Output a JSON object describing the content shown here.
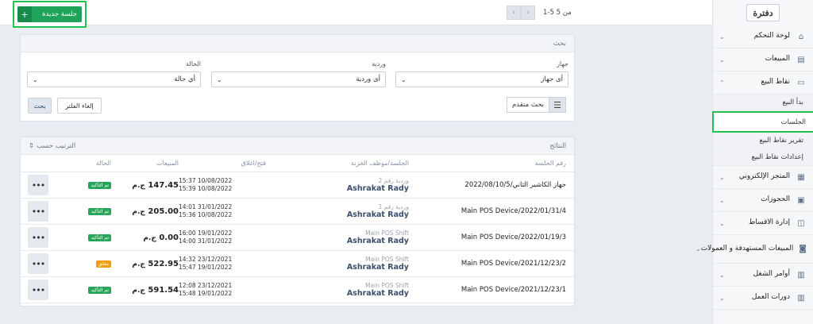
{
  "sidebar": {
    "logo": "دفترة",
    "items": [
      {
        "label": "لوحة التحكم",
        "icon": "home-icon",
        "glyph": "⌂",
        "chevron": "⌄"
      },
      {
        "label": "المبيعات",
        "icon": "sales-icon",
        "glyph": "▤",
        "chevron": "⌄"
      },
      {
        "label": "نقاط البيع",
        "icon": "pos-icon",
        "glyph": "▭",
        "chevron": "⌃"
      }
    ],
    "sub_items": [
      {
        "label": "بدأ البيع"
      },
      {
        "label": "الجلسات"
      },
      {
        "label": "تقرير نقاط البيع"
      },
      {
        "label": "إعدادات نقاط البيع"
      }
    ],
    "items_after": [
      {
        "label": "المتجر الإلكتروني",
        "icon": "store-icon",
        "glyph": "▦",
        "chevron": "⌄"
      },
      {
        "label": "الحجوزات",
        "icon": "calendar-icon",
        "glyph": "▣",
        "chevron": "⌄"
      },
      {
        "label": "إدارة الاقساط",
        "icon": "installments-icon",
        "glyph": "◫",
        "chevron": "⌄"
      },
      {
        "label": "المبيعات المستهدفة و العمولات",
        "icon": "commission-icon",
        "glyph": "◙",
        "chevron": "⌄"
      },
      {
        "label": "أوامر الشغل",
        "icon": "work-order-icon",
        "glyph": "▥",
        "chevron": "⌄"
      },
      {
        "label": "دورات العمل",
        "icon": "workflow-icon",
        "glyph": "▥",
        "chevron": "⌄"
      }
    ]
  },
  "topbar": {
    "new_session": "جلسة جديدة",
    "plus": "+",
    "pager_text": "1-5 من 5",
    "prev": "‹",
    "next": "›"
  },
  "filters": {
    "title": "بحث",
    "device_label": "جهاز",
    "device_value": "أى جهاز",
    "shift_label": "وردية",
    "shift_value": "أى وردية",
    "status_label": "الحالة",
    "status_value": "أي حالة",
    "advanced": "بحث متقدم",
    "clear": "إلغاء الفلتر",
    "search": "بحث",
    "arrow": "⌄"
  },
  "results": {
    "title": "النتائج",
    "sort": "الترتيب حسب",
    "columns": {
      "number": "رقم الجلسة",
      "staff": "الجلسة/موظف الخزنة",
      "time": "فتح/اغلاق",
      "sales": "المبيعات",
      "status": "الحالة"
    },
    "currency": "ج.م",
    "more": "•••",
    "rows": [
      {
        "number": "جهاز الكاشير الثاني/2022/08/10/5",
        "shift": "وردية رقم 2",
        "name": "Ashrakat Rady",
        "open": "15:37 10/08/2022",
        "close": "15:39 10/08/2022",
        "sales": "147.45",
        "status": "تم التأكيد",
        "closed": false
      },
      {
        "number": "Main POS Device/2022/01/31/4",
        "shift": "وردية رقم 1",
        "name": "Ashrakat Rady",
        "open": "14:01 31/01/2022",
        "close": "15:36 10/08/2022",
        "sales": "205.00",
        "status": "تم التأكيد",
        "closed": false
      },
      {
        "number": "Main POS Device/2022/01/19/3",
        "shift": "Main POS Shift",
        "name": "Ashrakat Rady",
        "open": "16:00 19/01/2022",
        "close": "14:00 31/01/2022",
        "sales": "0.00",
        "status": "تم التأكيد",
        "closed": false
      },
      {
        "number": "Main POS Device/2021/12/23/2",
        "shift": "Main POS Shift",
        "name": "Ashrakat Rady",
        "open": "14:32 23/12/2021",
        "close": "15:47 19/01/2022",
        "sales": "522.95",
        "status": "مغلق",
        "closed": true
      },
      {
        "number": "Main POS Device/2021/12/23/1",
        "shift": "Main POS Shift",
        "name": "Ashrakat Rady",
        "open": "12:08 23/12/2021",
        "close": "15:48 19/01/2022",
        "sales": "591.54",
        "status": "تم التأكيد",
        "closed": false
      }
    ]
  }
}
